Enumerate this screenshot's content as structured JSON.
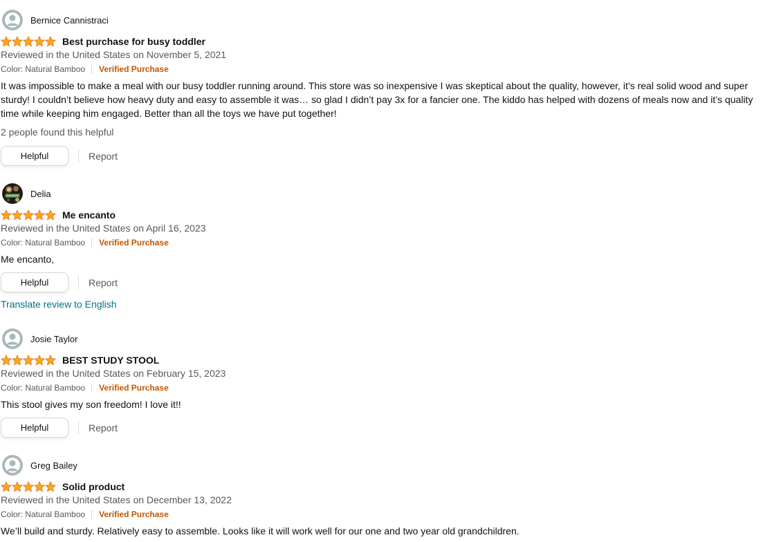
{
  "colors": {
    "star": "#ffa41c",
    "verified": "#c45500",
    "link": "#007185",
    "muted": "#565959",
    "text": "#0f1111"
  },
  "reviews": [
    {
      "reviewer": "Bernice Cannistraci",
      "avatar": "default-avatar-icon",
      "rating": 5,
      "title": "Best purchase for busy toddler",
      "date": "Reviewed in the United States on November 5, 2021",
      "variant": "Color: Natural Bamboo",
      "verified": "Verified Purchase",
      "body": "It was impossible to make a meal with our busy toddler running around. This store was so inexpensive I was skeptical about the quality, however, it’s real solid wood and super sturdy! I couldn’t believe how heavy duty and easy to assemble it was… so glad I didn’t pay 3x for a fancier one. The kiddo has helped with dozens of meals now and it’s quality time while keeping him engaged. Better than all the toys we have put together!",
      "helpful_count": "2 people found this helpful",
      "helpful_label": "Helpful",
      "report_label": "Report"
    },
    {
      "reviewer": "Delia",
      "avatar": "photo-avatar-icon",
      "rating": 5,
      "title": "Me encanto",
      "date": "Reviewed in the United States on April 16, 2023",
      "variant": "Color: Natural Bamboo",
      "verified": "Verified Purchase",
      "body": "Me encanto,",
      "helpful_label": "Helpful",
      "report_label": "Report",
      "translate_label": "Translate review to English"
    },
    {
      "reviewer": "Josie Taylor",
      "avatar": "default-avatar-icon",
      "rating": 5,
      "title": "BEST STUDY STOOL",
      "date": "Reviewed in the United States on February 15, 2023",
      "variant": "Color: Natural Bamboo",
      "verified": "Verified Purchase",
      "body": "This stool gives my son freedom! I love it!!",
      "helpful_label": "Helpful",
      "report_label": "Report"
    },
    {
      "reviewer": "Greg Bailey",
      "avatar": "default-avatar-icon",
      "rating": 5,
      "title": "Solid product",
      "date": "Reviewed in the United States on December 13, 2022",
      "variant": "Color: Natural Bamboo",
      "verified": "Verified Purchase",
      "body": "We’ll build and sturdy. Relatively easy to assemble. Looks like it will work well for our one and two year old grandchildren."
    }
  ]
}
